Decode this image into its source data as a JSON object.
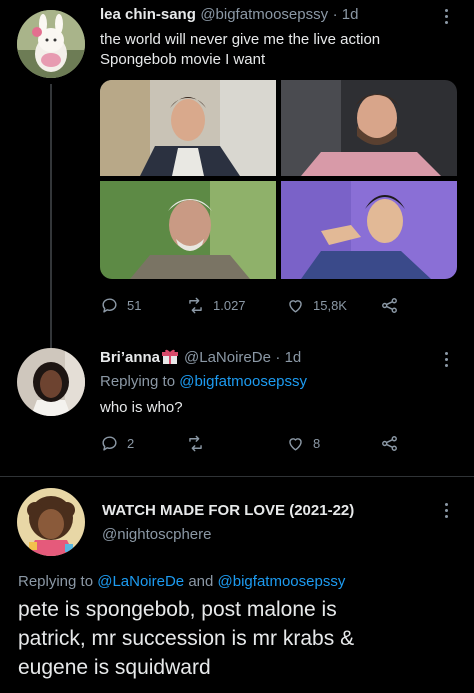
{
  "tweet1": {
    "name": "lea chin-sang",
    "handle": "@bigfatmoosepssy",
    "time": "· 1d",
    "text_line1": "the world will never give me the live action",
    "text_line2": "Spongebob movie I want",
    "replies": "51",
    "retweets": "1.027",
    "likes": "15,8K"
  },
  "tweet2": {
    "name": "Bri’anna",
    "handle": "@LaNoireDe",
    "time": "· 1d",
    "replying_prefix": "Replying to",
    "replying_to": "@bigfatmoosepssy",
    "text": "who is who?",
    "replies": "2",
    "likes": "8"
  },
  "tweet3": {
    "name": "WATCH MADE FOR LOVE (2021-22)",
    "handle": "@nightoscphere",
    "replying_prefix": "Replying to",
    "replying_to_1": "@LaNoireDe",
    "replying_and": "and",
    "replying_to_2": "@bigfatmoosepssy",
    "text_line1": "pete is spongebob, post malone is",
    "text_line2": "patrick, mr succession is mr krabs &",
    "text_line3": "eugene is squidward"
  },
  "colors": {
    "background": "#000000",
    "link": "#1d9bf0",
    "muted": "#8b98a5"
  },
  "icons": [
    "reply-icon",
    "retweet-icon",
    "like-icon",
    "share-icon",
    "more-icon",
    "gift-emoji-icon"
  ]
}
